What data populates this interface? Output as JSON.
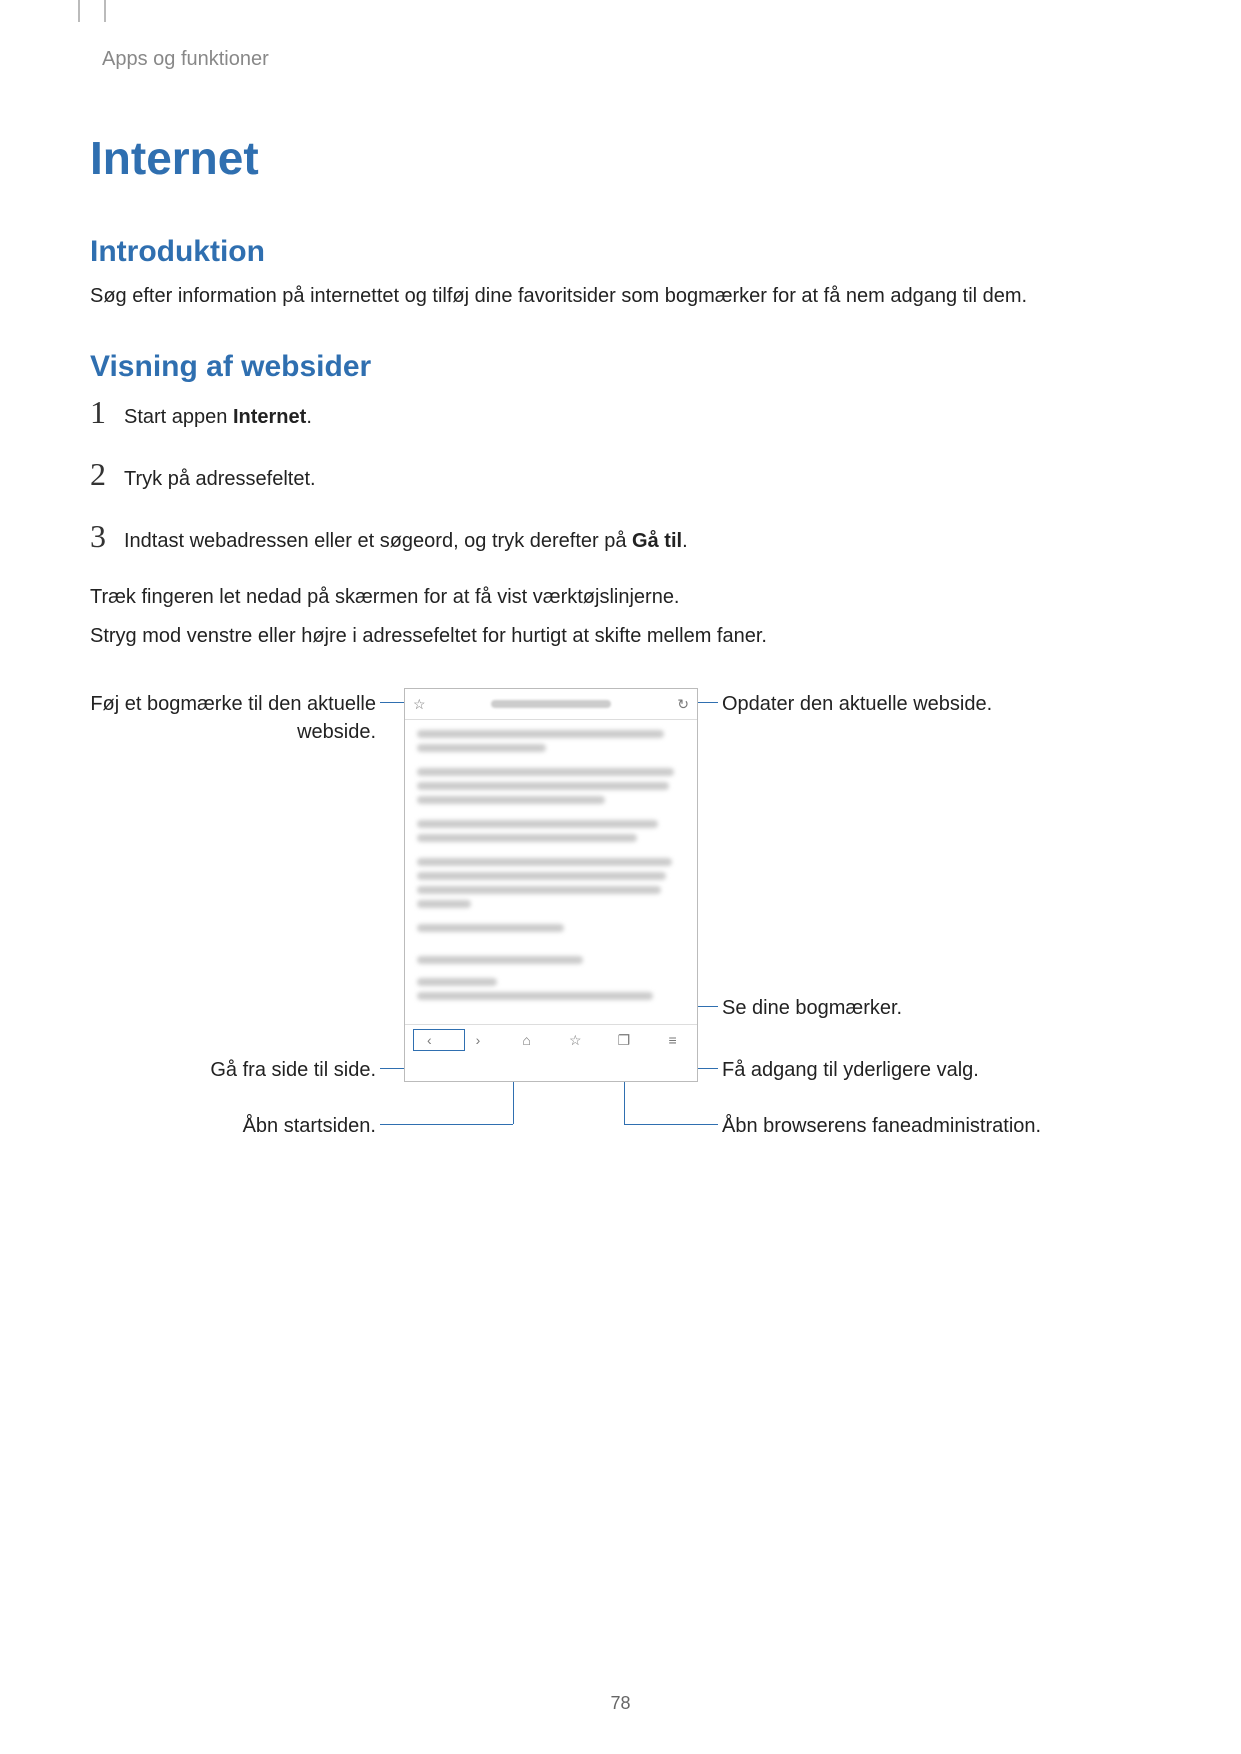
{
  "breadcrumb": "Apps og funktioner",
  "title": "Internet",
  "sections": {
    "intro": {
      "heading": "Introduktion",
      "text": "Søg efter information på internettet og tilføj dine favoritsider som bogmærker for at få nem adgang til dem."
    },
    "viewing": {
      "heading": "Visning af websider",
      "steps": {
        "s1_pre": "Start appen ",
        "s1_bold": "Internet",
        "s1_post": ".",
        "s2": "Tryk på adressefeltet.",
        "s3_pre": "Indtast webadressen eller et søgeord, og tryk derefter på ",
        "s3_bold": "Gå til",
        "s3_post": "."
      },
      "p1": "Træk fingeren let nedad på skærmen for at få vist værktøjslinjerne.",
      "p2": "Stryg mod venstre eller højre i adressefeltet for hurtigt at skifte mellem faner."
    }
  },
  "callouts": {
    "bookmark_add": "Føj et bogmærke til den aktuelle webside.",
    "refresh": "Opdater den aktuelle webside.",
    "bookmarks_view": "Se dine bogmærker.",
    "nav": "Gå fra side til side.",
    "more": "Få adgang til yderligere valg.",
    "home": "Åbn startsiden.",
    "tabs": "Åbn browserens faneadministration."
  },
  "page_number": "78"
}
